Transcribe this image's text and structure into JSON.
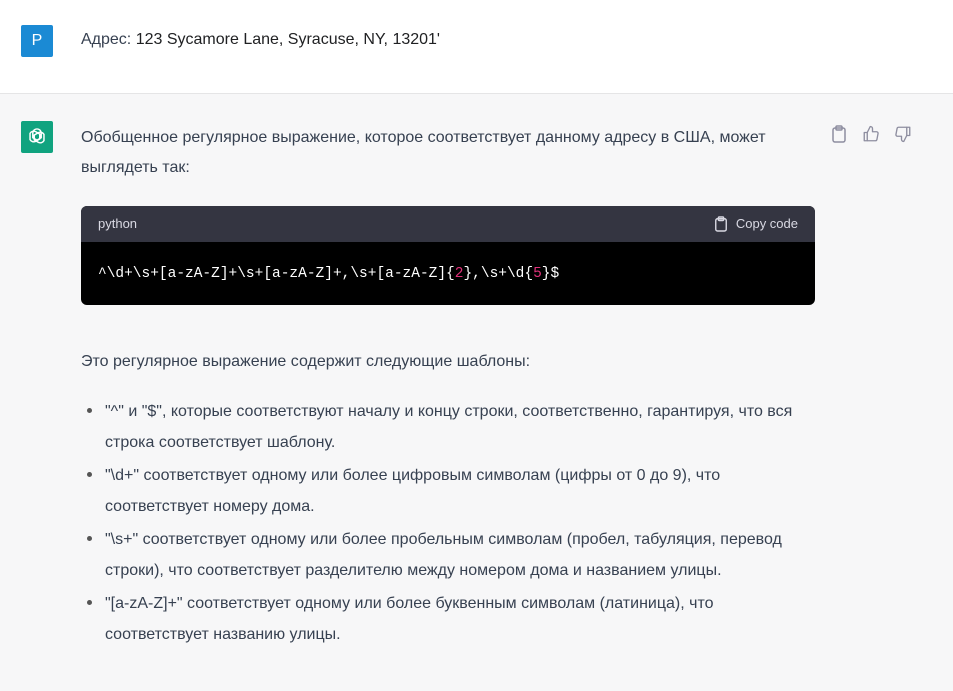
{
  "user_message": {
    "avatar_letter": "P",
    "prefix": "Адрес: ",
    "address": "123 Sycamore Lane, Syracuse, NY, 13201'"
  },
  "assistant_message": {
    "intro": "Обобщенное регулярное выражение, которое соответствует данному адресу в США, может выглядеть так:",
    "code": {
      "language": "python",
      "copy_label": "Copy code",
      "part1": "^\\d+\\s+[a-zA-Z]+\\s+[a-zA-Z]+,\\s+[a-zA-Z]{",
      "num1": "2",
      "part2": "},\\s+\\d{",
      "num2": "5",
      "part3": "}$"
    },
    "explanation": "Это регулярное выражение содержит следующие шаблоны:",
    "bullets": [
      "\"^\" и \"$\", которые соответствуют началу и концу строки, соответственно, гарантируя, что вся строка соответствует шаблону.",
      "\"\\d+\" соответствует одному или более цифровым символам (цифры от 0 до 9), что соответствует номеру дома.",
      "\"\\s+\" соответствует одному или более пробельным символам (пробел, табуляция, перевод строки), что соответствует разделителю между номером дома и названием улицы.",
      "\"[a-zA-Z]+\" соответствует одному или более буквенным символам (латиница), что соответствует названию улицы."
    ]
  },
  "colors": {
    "user_avatar": "#1b8ad4",
    "bot_avatar": "#10a37f",
    "code_bg": "#000000",
    "code_header": "#343541",
    "code_number": "#df3079"
  },
  "icons": [
    "openai-logo-icon",
    "clipboard-icon",
    "thumbs-up-icon",
    "thumbs-down-icon"
  ]
}
